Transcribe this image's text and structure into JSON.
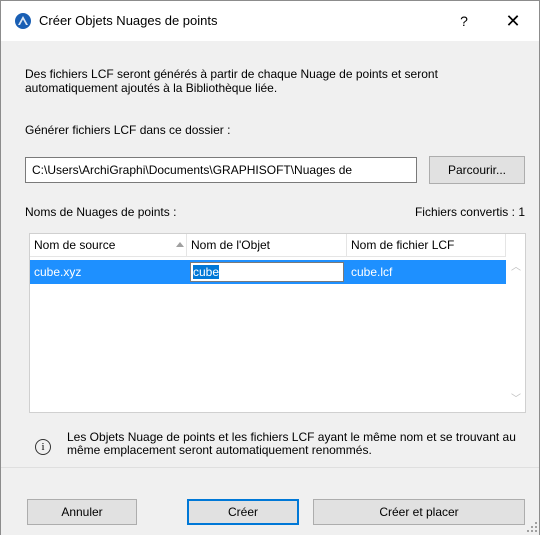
{
  "window": {
    "title": "Créer Objets Nuages de points",
    "help_label": "?",
    "close_label": "✕"
  },
  "description": "Des fichiers LCF seront générés à partir de chaque Nuage de points et seront automatiquement ajoutés à la Bibliothèque liée.",
  "folder": {
    "label": "Générer fichiers LCF dans ce dossier :",
    "path_value": "C:\\Users\\ArchiGraphi\\Documents\\GRAPHISOFT\\Nuages de",
    "browse_label": "Parcourir..."
  },
  "list": {
    "label": "Noms de Nuages de points :",
    "converted_count": "Fichiers convertis : 1",
    "columns": [
      "Nom de source",
      "Nom de l'Objet",
      "Nom de fichier LCF"
    ],
    "rows": [
      {
        "source": "cube.xyz",
        "object_name": "cube",
        "lcf_file": "cube.lcf"
      }
    ]
  },
  "info": {
    "icon": "info-icon",
    "text": "Les Objets Nuage de points et les fichiers LCF ayant le même nom et se trouvant au même emplacement seront automatiquement renommés."
  },
  "buttons": {
    "cancel": "Annuler",
    "create": "Créer",
    "create_place": "Créer et placer"
  },
  "colors": {
    "selection": "#1e90ff",
    "default_button_border": "#0078d7",
    "app_icon": "#1a5fb4"
  }
}
